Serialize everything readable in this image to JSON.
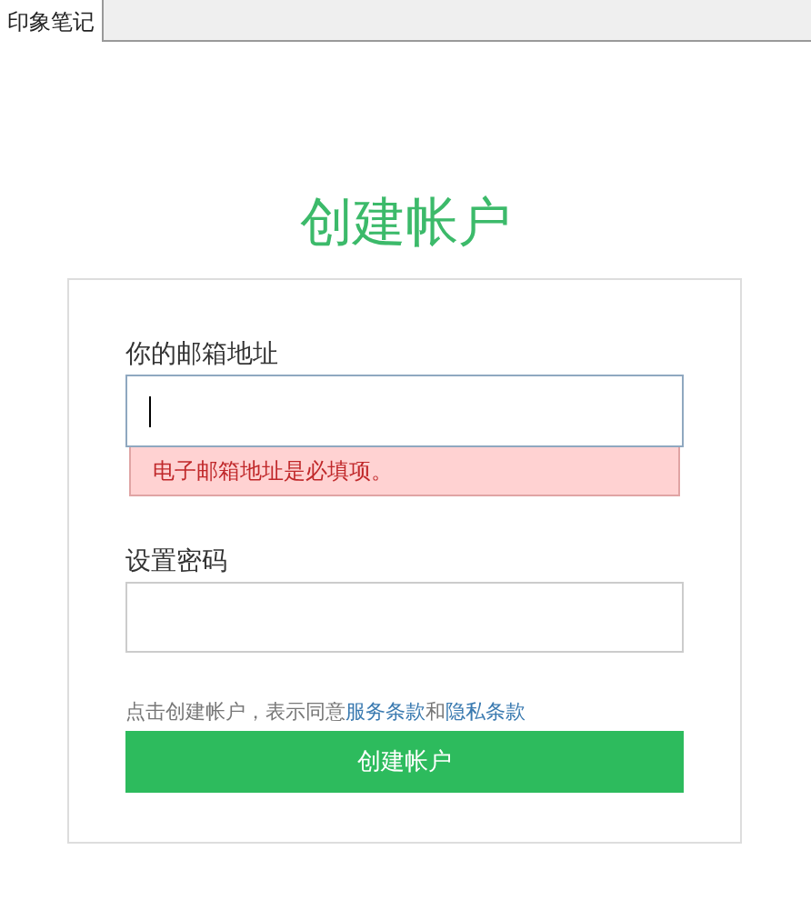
{
  "tabs": [
    {
      "label": "印象笔记",
      "selected": true
    }
  ],
  "title": "创建帐户",
  "fields": [
    {
      "label": "你的邮箱地址",
      "focused": true,
      "error": "电子邮箱地址是必填项。"
    },
    {
      "label": "设置密码",
      "focused": false
    }
  ],
  "terms": {
    "prefix": "点击创建帐户，表示同意",
    "link_1": "服务条款",
    "joiner": "和",
    "link_2": "隐私条款"
  },
  "submit_button": "创建帐户"
}
